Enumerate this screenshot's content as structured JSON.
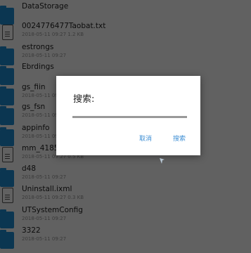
{
  "files": [
    {
      "name": "DataStorage",
      "sub": "",
      "type": "folder"
    },
    {
      "name": "0024776477Taobat.txt",
      "sub": "2018-05-11 09:27  1.2 KB",
      "type": "file"
    },
    {
      "name": "estrongs",
      "sub": "2018-05-11 09:27",
      "type": "folder"
    },
    {
      "name": "Ebrdings",
      "sub": "",
      "type": "folder"
    },
    {
      "name": "gs_fiin",
      "sub": "2018-05-11 09:27",
      "type": "folder"
    },
    {
      "name": "gs_fsn",
      "sub": "2018-05-11 09:27",
      "type": "folder"
    },
    {
      "name": "appinfo",
      "sub": "2018-05-11 09:27",
      "type": "folder"
    },
    {
      "name": "mm_4185",
      "sub": "2018-05-11 09:27  0.5 KB",
      "type": "file"
    },
    {
      "name": "d48",
      "sub": "2018-05-11 09:27",
      "type": "folder"
    },
    {
      "name": "Uninstall.ixml",
      "sub": "2018-05-11 09:27  0.3 KB",
      "type": "file"
    },
    {
      "name": "UTSystemConfig",
      "sub": "2018-05-11 09:27",
      "type": "folder"
    },
    {
      "name": "3322",
      "sub": "2018-05-11 09:27",
      "type": "folder"
    }
  ],
  "dialog": {
    "title": "搜索:",
    "input_value": "",
    "cancel_label": "取消",
    "search_label": "搜索"
  },
  "colors": {
    "accent": "#3f8fd4",
    "folder": "#1f8fd6"
  }
}
